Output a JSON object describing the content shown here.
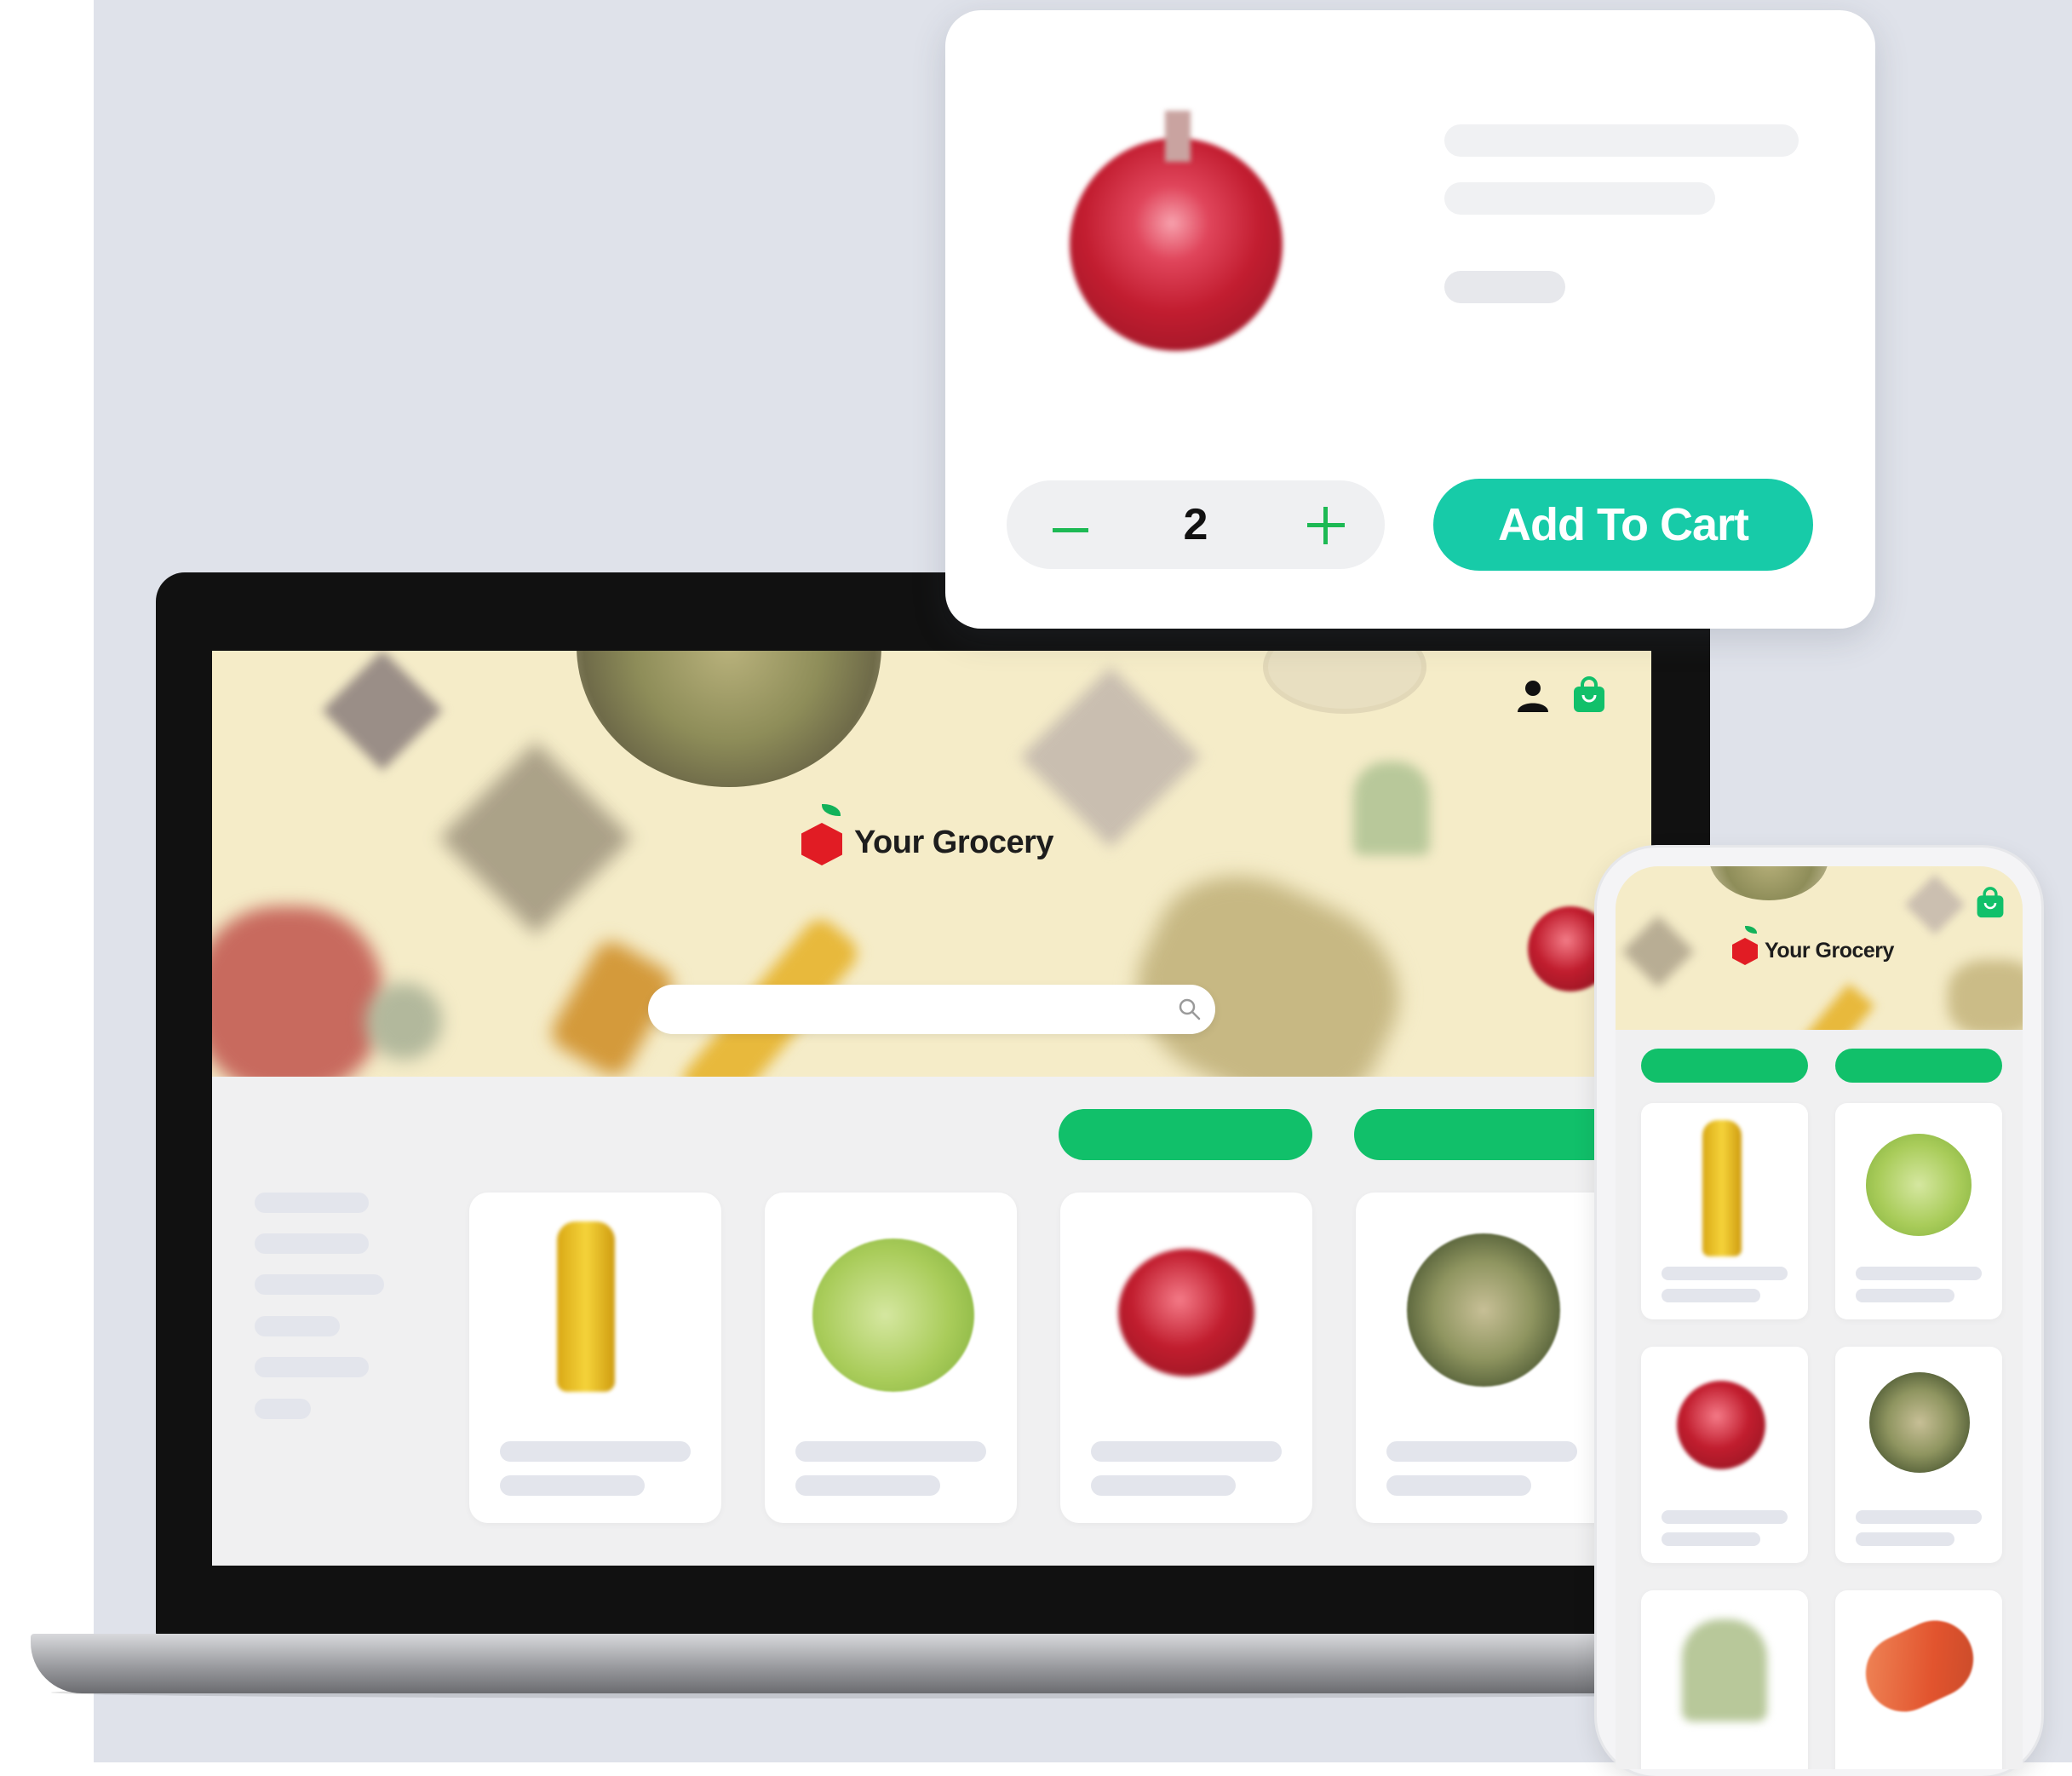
{
  "brand": {
    "name": "Your Grocery",
    "accent_green": "#11c06a",
    "logo_red": "#e11c24",
    "cta_teal": "#17cba8",
    "hero_bg": "#f5ecc8"
  },
  "desktop": {
    "header_icons": [
      "user-icon",
      "shopping-bag-icon"
    ],
    "search": {
      "placeholder": "",
      "icon": "search-icon"
    },
    "products": [
      {
        "image": "juice-bottle"
      },
      {
        "image": "lettuce"
      },
      {
        "image": "red-onion"
      },
      {
        "image": "salad-bowl"
      }
    ]
  },
  "product_popup": {
    "image": "red-onion",
    "quantity": "2",
    "add_to_cart_label": "Add To Cart",
    "minus_icon": "minus-icon",
    "plus_icon": "plus-icon"
  },
  "mobile": {
    "header_icons": [
      "shopping-bag-icon"
    ],
    "products": [
      {
        "image": "juice-bottle"
      },
      {
        "image": "lettuce"
      },
      {
        "image": "red-onion"
      },
      {
        "image": "salad-bowl"
      },
      {
        "image": "broccoli"
      },
      {
        "image": "salmon"
      }
    ]
  }
}
